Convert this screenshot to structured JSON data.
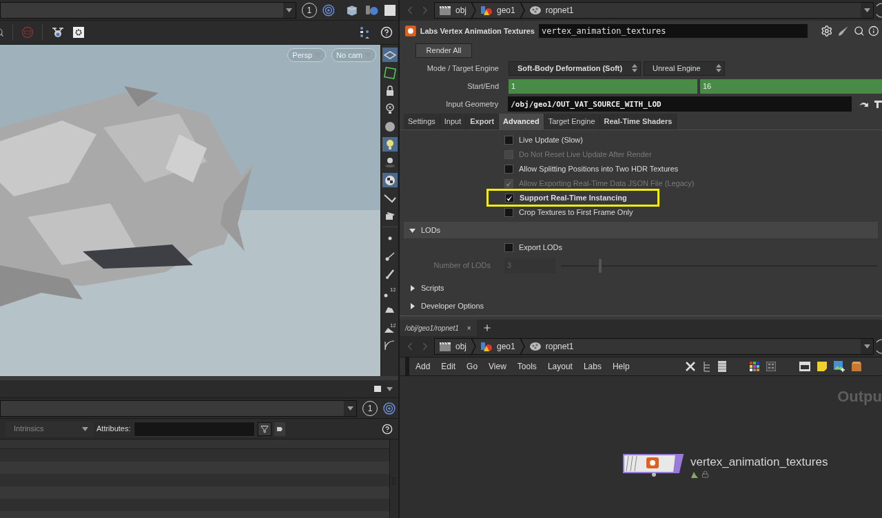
{
  "viewport": {
    "frame": "1",
    "view_menus": [
      "Persp",
      "No cam"
    ],
    "side_tools": [
      {
        "selected": true
      },
      {
        "selected": false
      },
      {
        "selected": false
      },
      {
        "selected": false
      },
      {
        "selected": false
      },
      {
        "selected": true
      },
      {
        "selected": false
      },
      {
        "selected": true
      },
      {
        "selected": false
      },
      {
        "selected": false
      },
      {
        "selected": false
      },
      {
        "selected": false
      },
      {
        "selected": false
      },
      {
        "selected": false,
        "label": "12"
      },
      {
        "selected": false
      },
      {
        "selected": false,
        "label": "12"
      },
      {
        "selected": false
      }
    ]
  },
  "spreadsheet": {
    "frame": "1",
    "filter": "Intrinsics",
    "attributes_label": "Attributes:"
  },
  "parameters": {
    "breadcrumbs": [
      "obj",
      "geo1",
      "ropnet1"
    ],
    "node_type": "Labs Vertex Animation Textures",
    "node_name": "vertex_animation_textures",
    "render_button": "Render All",
    "mode_label": "Mode / Target Engine",
    "mode": "Soft-Body Deformation (Soft)",
    "engine": "Unreal Engine",
    "range_label": "Start/End",
    "start": "1",
    "end": "16",
    "input_label": "Input Geometry",
    "input_path": "/obj/geo1/OUT_VAT_SOURCE_WITH_LOD",
    "tabs": [
      {
        "label": "Settings",
        "selected": false,
        "modified": false
      },
      {
        "label": "Input",
        "selected": false,
        "modified": false
      },
      {
        "label": "Export",
        "selected": false,
        "modified": true
      },
      {
        "label": "Advanced",
        "selected": true,
        "modified": true
      },
      {
        "label": "Target Engine",
        "selected": false,
        "modified": false
      },
      {
        "label": "Real-Time Shaders",
        "selected": false,
        "modified": true
      }
    ],
    "options": [
      {
        "label": "Live Update (Slow)",
        "checked": false,
        "disabled": false,
        "highlighted": false
      },
      {
        "label": "Do Not Reset Live Update After Render",
        "checked": false,
        "disabled": true,
        "highlighted": false
      },
      {
        "label": "Allow Splitting Positions into Two HDR Textures",
        "checked": false,
        "disabled": false,
        "highlighted": false
      },
      {
        "label": "Allow Exporting Real-Time Data JSON File (Legacy)",
        "checked": true,
        "disabled": true,
        "highlighted": false
      },
      {
        "label": "Support Real-Time Instancing",
        "checked": true,
        "disabled": false,
        "highlighted": true
      },
      {
        "label": "Crop Textures to First Frame Only",
        "checked": false,
        "disabled": false,
        "highlighted": false
      }
    ],
    "sections": [
      {
        "title": "LODs",
        "expanded": true,
        "export_label": "Export LODs",
        "export_checked": false,
        "count_label": "Number of LODs",
        "count": "3",
        "level": 0.12
      },
      {
        "title": "Scripts",
        "expanded": false
      },
      {
        "title": "Developer Options",
        "expanded": false
      }
    ]
  },
  "network": {
    "tab": "/obj/geo1/ropnet1",
    "tab_close": "×",
    "breadcrumbs": [
      "obj",
      "geo1",
      "ropnet1"
    ],
    "menu": [
      "Add",
      "Edit",
      "Go",
      "View",
      "Tools",
      "Layout",
      "Labs",
      "Help"
    ],
    "context_label": "Outpu",
    "node_name": "vertex_animation_textures"
  }
}
